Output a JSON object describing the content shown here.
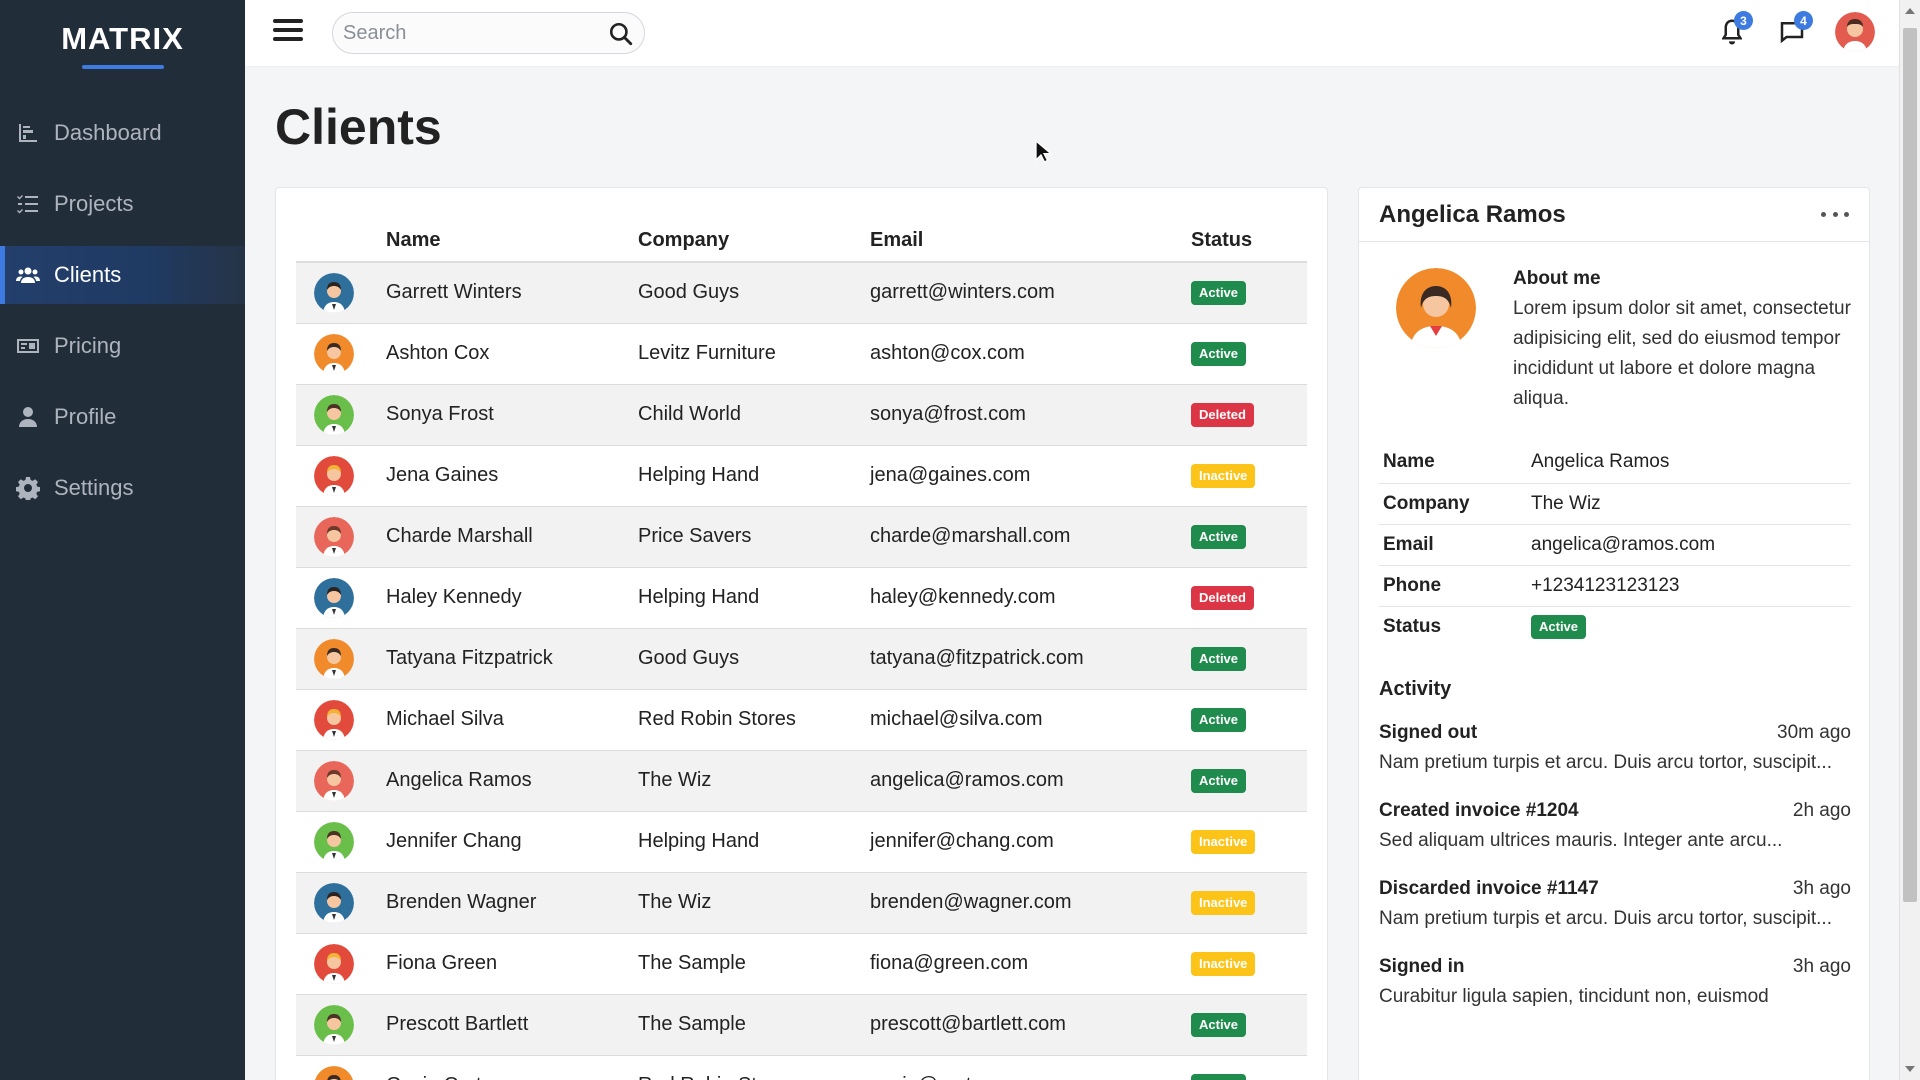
{
  "brand": "MATRIX",
  "sidebar": {
    "items": [
      {
        "label": "Dashboard",
        "icon": "chart-icon"
      },
      {
        "label": "Projects",
        "icon": "tasks-icon"
      },
      {
        "label": "Clients",
        "icon": "users-icon",
        "active": true
      },
      {
        "label": "Pricing",
        "icon": "money-icon"
      },
      {
        "label": "Profile",
        "icon": "user-icon"
      },
      {
        "label": "Settings",
        "icon": "gear-icon"
      }
    ]
  },
  "topbar": {
    "search_placeholder": "Search",
    "notifications_count": "3",
    "messages_count": "4"
  },
  "page": {
    "title": "Clients"
  },
  "table": {
    "headers": {
      "name": "Name",
      "company": "Company",
      "email": "Email",
      "status": "Status"
    },
    "rows": [
      {
        "name": "Garrett Winters",
        "company": "Good Guys",
        "email": "garrett@winters.com",
        "status": "Active",
        "avatar": "blue"
      },
      {
        "name": "Ashton Cox",
        "company": "Levitz Furniture",
        "email": "ashton@cox.com",
        "status": "Active",
        "avatar": "orange"
      },
      {
        "name": "Sonya Frost",
        "company": "Child World",
        "email": "sonya@frost.com",
        "status": "Deleted",
        "avatar": "green"
      },
      {
        "name": "Jena Gaines",
        "company": "Helping Hand",
        "email": "jena@gaines.com",
        "status": "Inactive",
        "avatar": "red"
      },
      {
        "name": "Charde Marshall",
        "company": "Price Savers",
        "email": "charde@marshall.com",
        "status": "Active",
        "avatar": "coral"
      },
      {
        "name": "Haley Kennedy",
        "company": "Helping Hand",
        "email": "haley@kennedy.com",
        "status": "Deleted",
        "avatar": "blue"
      },
      {
        "name": "Tatyana Fitzpatrick",
        "company": "Good Guys",
        "email": "tatyana@fitzpatrick.com",
        "status": "Active",
        "avatar": "orange"
      },
      {
        "name": "Michael Silva",
        "company": "Red Robin Stores",
        "email": "michael@silva.com",
        "status": "Active",
        "avatar": "red"
      },
      {
        "name": "Angelica Ramos",
        "company": "The Wiz",
        "email": "angelica@ramos.com",
        "status": "Active",
        "avatar": "coral"
      },
      {
        "name": "Jennifer Chang",
        "company": "Helping Hand",
        "email": "jennifer@chang.com",
        "status": "Inactive",
        "avatar": "green"
      },
      {
        "name": "Brenden Wagner",
        "company": "The Wiz",
        "email": "brenden@wagner.com",
        "status": "Inactive",
        "avatar": "blue"
      },
      {
        "name": "Fiona Green",
        "company": "The Sample",
        "email": "fiona@green.com",
        "status": "Inactive",
        "avatar": "red"
      },
      {
        "name": "Prescott Bartlett",
        "company": "The Sample",
        "email": "prescott@bartlett.com",
        "status": "Active",
        "avatar": "green"
      },
      {
        "name": "Gavin Cortez",
        "company": "Red Robin Stores",
        "email": "gavin@cortez.com",
        "status": "Active",
        "avatar": "orange"
      }
    ]
  },
  "detail": {
    "name": "Angelica Ramos",
    "about_title": "About me",
    "about_text": "Lorem ipsum dolor sit amet, consectetur adipisicing elit, sed do eiusmod tempor incididunt ut labore et dolore magna aliqua.",
    "fields": [
      {
        "label": "Name",
        "value": "Angelica Ramos"
      },
      {
        "label": "Company",
        "value": "The Wiz"
      },
      {
        "label": "Email",
        "value": "angelica@ramos.com"
      },
      {
        "label": "Phone",
        "value": "+1234123123123"
      },
      {
        "label": "Status",
        "value": "Active"
      }
    ],
    "activity_title": "Activity",
    "activity": [
      {
        "event": "Signed out",
        "time": "30m ago",
        "desc": "Nam pretium turpis et arcu. Duis arcu tortor, suscipit..."
      },
      {
        "event": "Created invoice #1204",
        "time": "2h ago",
        "desc": "Sed aliquam ultrices mauris. Integer ante arcu..."
      },
      {
        "event": "Discarded invoice #1147",
        "time": "3h ago",
        "desc": "Nam pretium turpis et arcu. Duis arcu tortor, suscipit..."
      },
      {
        "event": "Signed in",
        "time": "3h ago",
        "desc": "Curabitur ligula sapien, tincidunt non, euismod"
      }
    ]
  },
  "colors": {
    "sidebar_bg": "#222d3a",
    "accent": "#3d7be0",
    "active": "#1f8b4c",
    "deleted": "#dc3545",
    "inactive": "#fcc319"
  }
}
